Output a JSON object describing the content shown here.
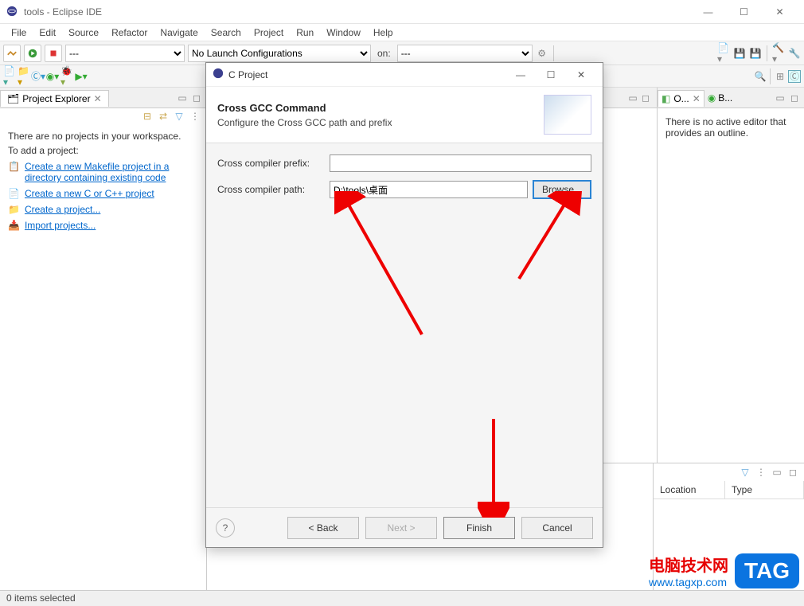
{
  "window": {
    "title": "tools - Eclipse IDE"
  },
  "menus": [
    "File",
    "Edit",
    "Source",
    "Refactor",
    "Navigate",
    "Search",
    "Project",
    "Run",
    "Window",
    "Help"
  ],
  "toolbar": {
    "launch_config": "No Launch Configurations",
    "on_label": "on:",
    "debug_dropdown": "---",
    "target_dropdown": "---"
  },
  "project_explorer": {
    "tab_title": "Project Explorer",
    "empty_msg_1": "There are no projects in your workspace.",
    "empty_msg_2": "To add a project:",
    "links": [
      "Create a new Makefile project in a directory containing existing code",
      "Create a new C or C++ project",
      "Create a project...",
      "Import projects..."
    ]
  },
  "outline": {
    "tab1": "O...",
    "tab2": "B...",
    "msg": "There is no active editor that provides an outline."
  },
  "problems": {
    "filter_label": "",
    "columns": [
      "Location",
      "Type"
    ]
  },
  "statusbar": {
    "text": "0 items selected"
  },
  "dialog": {
    "title": "C Project",
    "heading": "Cross GCC Command",
    "subheading": "Configure the Cross GCC path and prefix",
    "prefix_label": "Cross compiler prefix:",
    "prefix_value": "",
    "path_label": "Cross compiler path:",
    "path_value": "D:\\tools\\桌面",
    "browse": "Browse...",
    "back": "< Back",
    "next": "Next >",
    "finish": "Finish",
    "cancel": "Cancel"
  },
  "watermark": {
    "cn": "电脑技术网",
    "url": "www.tagxp.com",
    "tag": "TAG"
  }
}
